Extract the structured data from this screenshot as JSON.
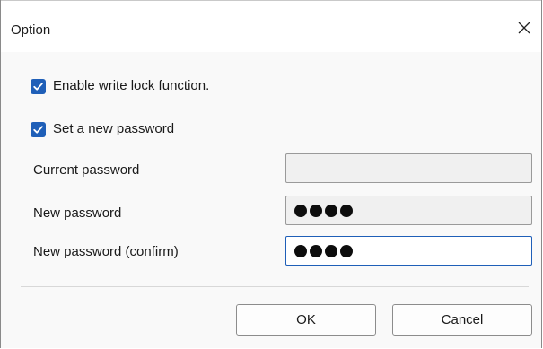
{
  "window": {
    "title": "Option",
    "close_icon": "close-icon"
  },
  "options": {
    "write_lock": {
      "label": "Enable write lock function.",
      "checked": true
    },
    "new_password": {
      "label": "Set a new password",
      "checked": true
    }
  },
  "fields": {
    "current": {
      "label": "Current password",
      "value": ""
    },
    "new": {
      "label": "New password",
      "value": "●●●●"
    },
    "confirm": {
      "label": "New password (confirm)",
      "value": "●●●●"
    }
  },
  "buttons": {
    "ok": "OK",
    "cancel": "Cancel"
  },
  "colors": {
    "accent": "#1f5fb8",
    "field_bg": "#f0f0f0",
    "dialog_bg": "#f9f9f9"
  }
}
